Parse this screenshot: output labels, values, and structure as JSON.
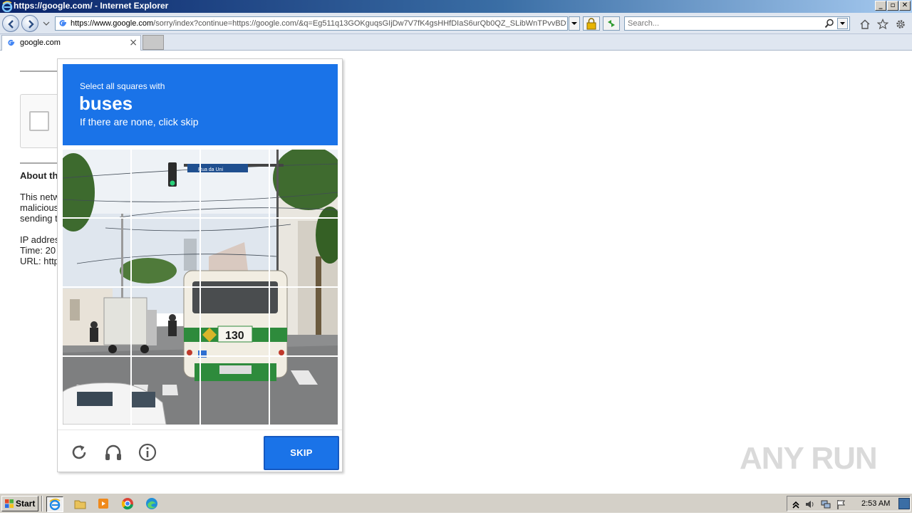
{
  "window": {
    "title": "https://google.com/ - Internet Explorer"
  },
  "address_bar": {
    "url_host": "https://www.google.com",
    "url_rest": "/sorry/index?continue=https://google.com/&q=Eg511q13GOKguqsGIjDw7V7fK4gsHHfDIaS6urQb0QZ_SLibWnTPvvBDwE",
    "search_placeholder": "Search..."
  },
  "tabs": [
    {
      "label": "google.com"
    }
  ],
  "page": {
    "about_heading": "About th",
    "lines": [
      "This netw",
      "malicious",
      "sending t"
    ],
    "ip_line": "IP addres",
    "time_line": "Time: 20",
    "url_line": "URL: http"
  },
  "challenge": {
    "pre": "Select all squares with",
    "object": "buses",
    "sub": "If there are none, click skip",
    "skip_label": "SKIP",
    "bus_number": "130",
    "street_sign": "Rua da Uni"
  },
  "watermark": {
    "text": "ANY RUN"
  },
  "taskbar": {
    "start_label": "Start",
    "clock": "2:53 AM"
  },
  "colors": {
    "accent": "#1a73e8",
    "titlebar": "#0a246a"
  }
}
